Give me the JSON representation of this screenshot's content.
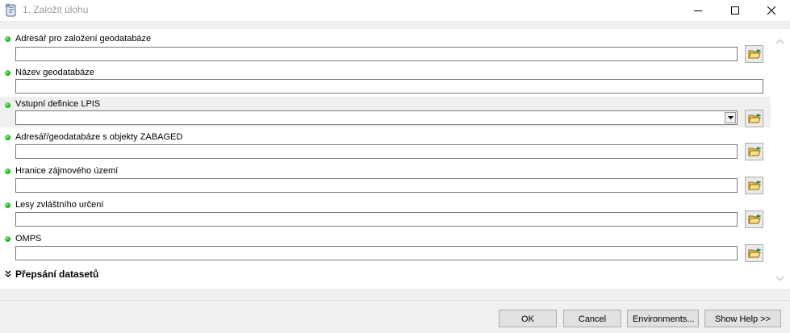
{
  "window": {
    "title": "1. Založit úlohu",
    "icon": "script-tool-icon",
    "controls": [
      "minimize-icon",
      "maximize-icon",
      "close-icon"
    ]
  },
  "params": [
    {
      "label": "Adresář pro založení geodatabáze",
      "type": "text",
      "value": "",
      "browse": true
    },
    {
      "label": "Název geodatabáze",
      "type": "text",
      "value": "",
      "browse": false
    },
    {
      "label": "Vstupní definice LPIS",
      "type": "select",
      "value": "",
      "browse": true
    },
    {
      "label": "Adresář/geodatabáze s objekty ZABAGED",
      "type": "text",
      "value": "",
      "browse": true
    },
    {
      "label": "Hranice zájmového území",
      "type": "text",
      "value": "",
      "browse": true
    },
    {
      "label": "Lesy zvláštního určení",
      "type": "text",
      "value": "",
      "browse": true
    },
    {
      "label": "OMPS",
      "type": "text",
      "value": "",
      "browse": true
    }
  ],
  "section": {
    "label": "Přepsání datasetů",
    "icon": "double-chevron-down-icon"
  },
  "footer": {
    "ok": "OK",
    "cancel": "Cancel",
    "environments": "Environments...",
    "show_help": "Show Help >>"
  }
}
